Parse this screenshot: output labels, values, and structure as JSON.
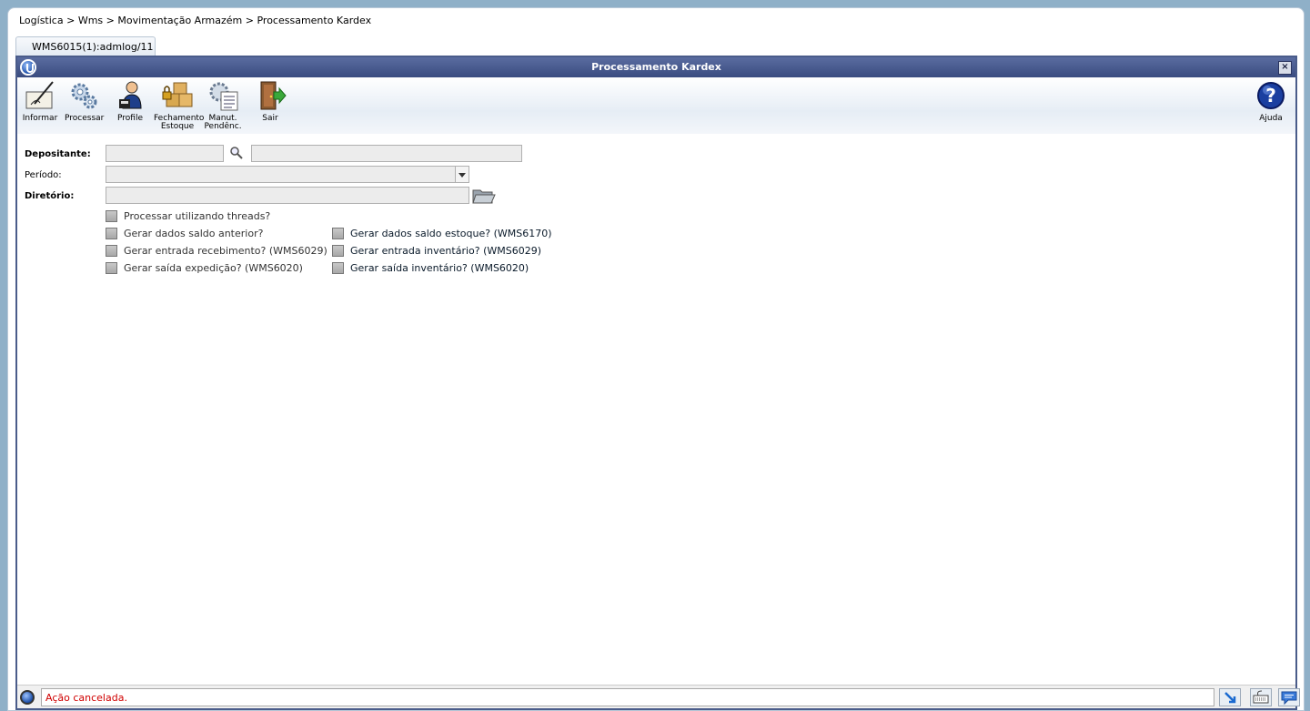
{
  "breadcrumb": {
    "items": [
      "Logística",
      "Wms",
      "Movimentação Armazém",
      "Processamento Kardex"
    ],
    "separator": " > "
  },
  "tab": {
    "label": "WMS6015(1):admlog/11"
  },
  "window": {
    "title": "Processamento Kardex",
    "close_label": "×"
  },
  "toolbar": {
    "informar": "Informar",
    "processar": "Processar",
    "profile": "Profile",
    "fechamento_line1": "Fechamento",
    "fechamento_line2": "Estoque",
    "manut_line1": "Manut.",
    "manut_line2": "Pendênc.",
    "sair": "Sair",
    "ajuda": "Ajuda"
  },
  "form": {
    "depositante_label": "Depositante:",
    "depositante_code": "",
    "depositante_name": "",
    "periodo_label": "Período:",
    "periodo_value": "",
    "diretorio_label": "Diretório:",
    "diretorio_value": ""
  },
  "checkboxes": {
    "threads": "Processar utilizando threads?",
    "saldo_anterior": "Gerar dados saldo anterior?",
    "entrada_recebimento": "Gerar entrada recebimento?  (WMS6029)",
    "saida_expedicao": "Gerar saída expedição? (WMS6020)",
    "saldo_estoque": "Gerar dados saldo estoque? (WMS6170)",
    "entrada_inventario": "Gerar entrada inventário? (WMS6029)",
    "saida_inventario": "Gerar saída inventário? (WMS6020)"
  },
  "status": {
    "message": "Ação cancelada.",
    "color": "#d00000"
  },
  "colors": {
    "titlebar": "#3a4c80",
    "background": "#8fb0c8"
  }
}
